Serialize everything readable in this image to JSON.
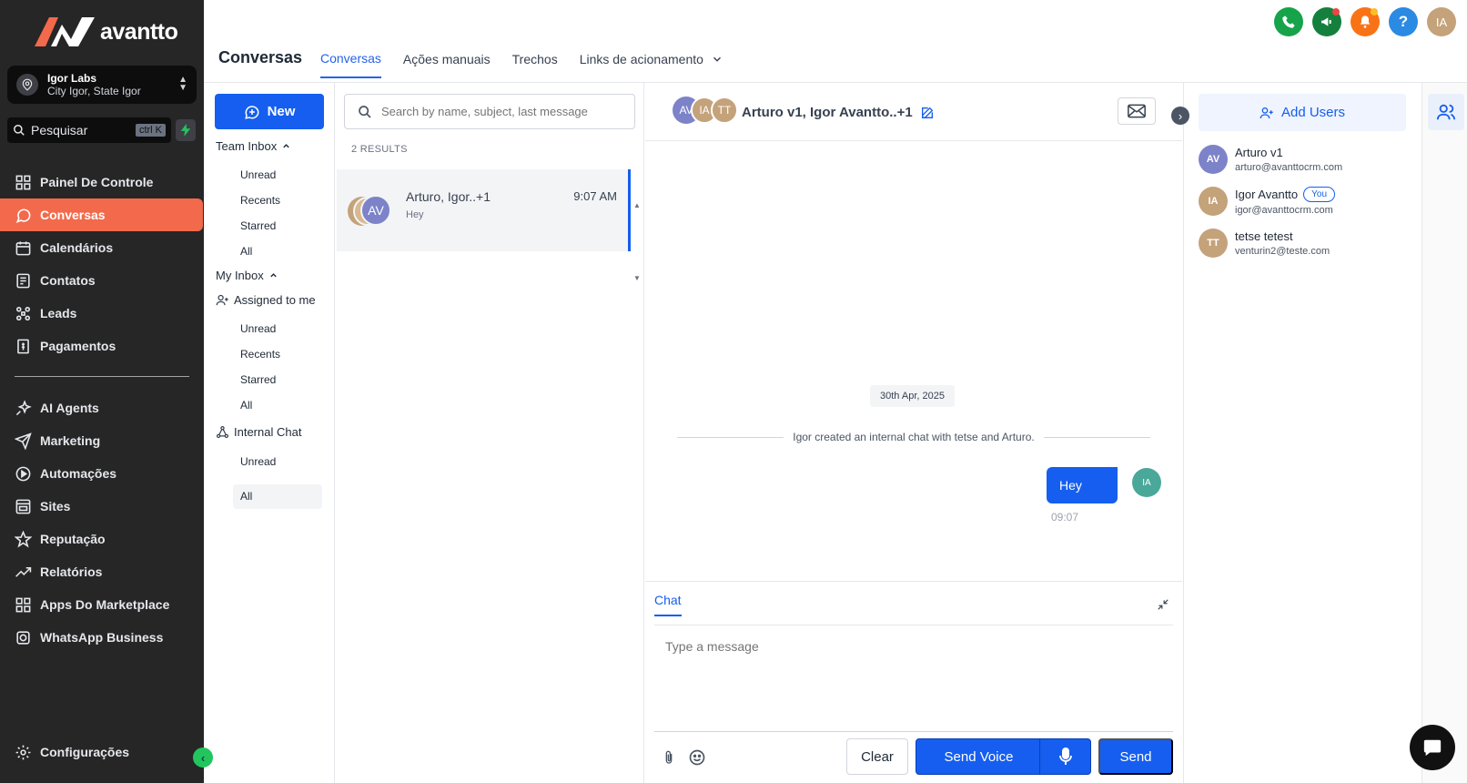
{
  "brand": {
    "name": "avantto"
  },
  "account": {
    "name": "Igor Labs",
    "location": "City Igor, State Igor"
  },
  "sidebar_search": {
    "placeholder": "Pesquisar",
    "shortcut": "ctrl K"
  },
  "nav": {
    "items": [
      {
        "label": "Painel De Controle",
        "icon": "dashboard-icon"
      },
      {
        "label": "Conversas",
        "icon": "chat-icon",
        "active": true
      },
      {
        "label": "Calendários",
        "icon": "calendar-icon"
      },
      {
        "label": "Contatos",
        "icon": "contacts-icon"
      },
      {
        "label": "Leads",
        "icon": "leads-icon"
      },
      {
        "label": "Pagamentos",
        "icon": "payments-icon"
      }
    ],
    "items2": [
      {
        "label": "AI Agents",
        "icon": "sparkle-icon"
      },
      {
        "label": "Marketing",
        "icon": "send-icon"
      },
      {
        "label": "Automações",
        "icon": "automation-icon"
      },
      {
        "label": "Sites",
        "icon": "sites-icon"
      },
      {
        "label": "Reputação",
        "icon": "star-icon"
      },
      {
        "label": "Relatórios",
        "icon": "trend-icon"
      },
      {
        "label": "Apps Do Marketplace",
        "icon": "apps-icon"
      },
      {
        "label": "WhatsApp Business",
        "icon": "whatsapp-icon"
      }
    ],
    "settings": "Configurações"
  },
  "header": {
    "title": "Conversas",
    "tabs": [
      "Conversas",
      "Ações manuais",
      "Trechos",
      "Links de acionamento"
    ],
    "avatar_initials": "IA"
  },
  "inbox": {
    "new_label": "New",
    "team_inbox": "Team Inbox",
    "team_items": [
      "Unread",
      "Recents",
      "Starred",
      "All"
    ],
    "my_inbox": "My Inbox",
    "assigned": "Assigned to me",
    "assigned_items": [
      "Unread",
      "Recents",
      "Starred",
      "All"
    ],
    "internal_chat": "Internal Chat",
    "internal_items": [
      "Unread",
      "All"
    ]
  },
  "list": {
    "search_placeholder": "Search by name, subject, last message",
    "results": "2 RESULTS",
    "conversations": [
      {
        "name": "Arturo, Igor..+1",
        "time": "9:07 AM",
        "preview": "Hey",
        "avatar": "AV"
      }
    ]
  },
  "chat": {
    "avatars": [
      "AV",
      "IA",
      "TT"
    ],
    "title": "Arturo v1, Igor Avantto..+1",
    "date": "30th Apr, 2025",
    "system_message": "Igor created an internal chat with tetse and Arturo.",
    "message": {
      "text": "Hey",
      "time": "09:07",
      "avatar": "IA"
    },
    "composer": {
      "tab": "Chat",
      "placeholder": "Type a message",
      "clear": "Clear",
      "send_voice": "Send Voice",
      "send": "Send"
    }
  },
  "members": {
    "add_label": "Add Users",
    "list": [
      {
        "initials": "AV",
        "name": "Arturo v1",
        "email": "arturo@avanttocrm.com",
        "color": "#7c83c9"
      },
      {
        "initials": "IA",
        "name": "Igor Avantto",
        "email": "igor@avanttocrm.com",
        "badge": "You",
        "color": "#c4a27a"
      },
      {
        "initials": "TT",
        "name": "tetse tetest",
        "email": "venturin2@teste.com",
        "color": "#c4a27a"
      }
    ]
  },
  "colors": {
    "accent": "#155eef",
    "sidebar": "#262626",
    "active_nav": "#f26a4b"
  }
}
